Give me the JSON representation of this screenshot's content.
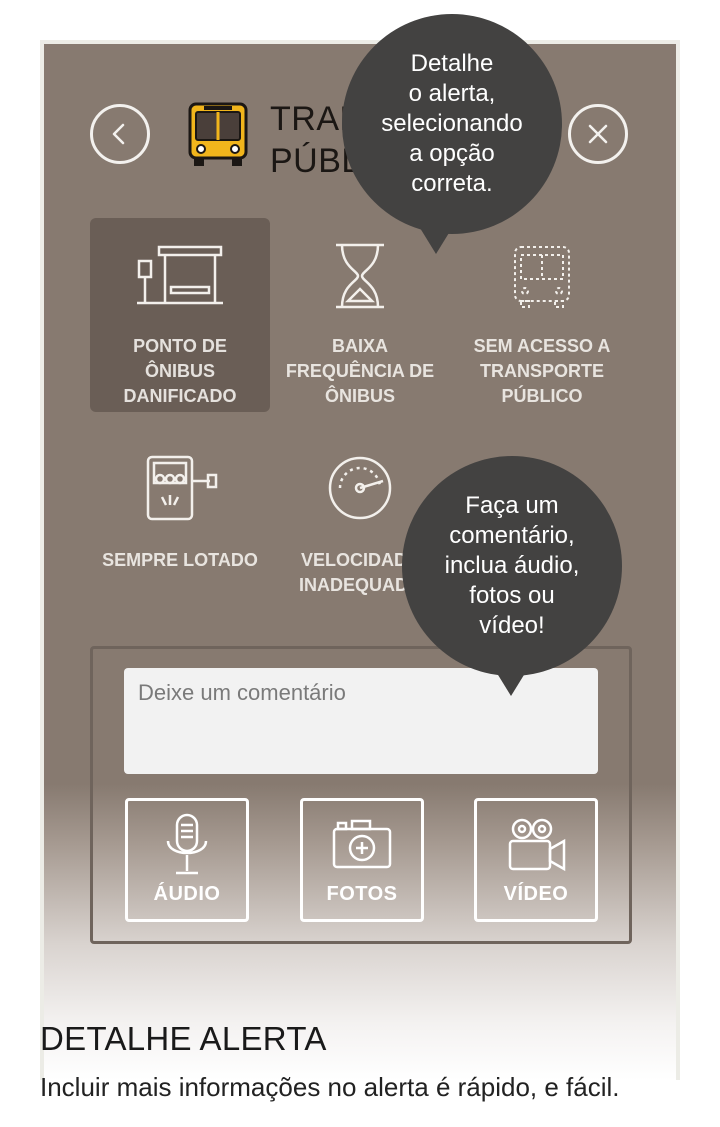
{
  "header": {
    "back_label": "voltar",
    "close_label": "fechar",
    "title_line1": "TRANSPORTE",
    "title_line2": "PÚBLICO",
    "category_icon": "bus-icon"
  },
  "options": [
    {
      "label_lines": [
        "PONTO DE",
        "ÔNIBUS",
        "DANIFICADO"
      ],
      "icon": "bus-stop-icon",
      "selected": true
    },
    {
      "label_lines": [
        "BAIXA",
        "FREQUÊNCIA DE",
        "ÔNIBUS"
      ],
      "icon": "hourglass-icon",
      "selected": false
    },
    {
      "label_lines": [
        "SEM ACESSO A",
        "TRANSPORTE",
        "PÚBLICO"
      ],
      "icon": "bus-outline-icon",
      "selected": false
    },
    {
      "label_lines": [
        "SEMPRE LOTADO"
      ],
      "icon": "crowded-bus-icon",
      "selected": false
    },
    {
      "label_lines": [
        "VELOCIDADE",
        "INADEQUADA"
      ],
      "icon": "speedometer-icon",
      "selected": false
    }
  ],
  "comment": {
    "placeholder": "Deixe um comentário",
    "value": ""
  },
  "media": {
    "audio_label": "ÁUDIO",
    "photos_label": "FOTOS",
    "video_label": "VÍDEO"
  },
  "tooltips": {
    "top_lines": [
      "Detalhe",
      "o alerta,",
      "selecionando",
      "a opção",
      "correta."
    ],
    "bottom_lines": [
      "Faça um",
      "comentário,",
      "inclua áudio,",
      "fotos ou",
      "vídeo!"
    ]
  },
  "caption": {
    "title": "DETALHE ALERTA",
    "text": "Incluir mais informações no alerta é rápido, e fácil."
  },
  "colors": {
    "screen_bg": "#877a70",
    "selected_tile": "#6a5e56",
    "bubble": "#434241",
    "bus_yellow": "#f1b51c"
  }
}
